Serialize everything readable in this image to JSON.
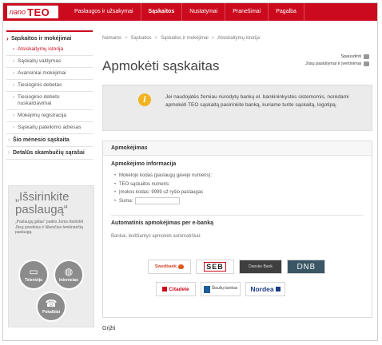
{
  "header": {
    "logo_nano": "nano",
    "logo_teo": "TEO",
    "nav": [
      "Paslaugos ir užsakymai",
      "Sąskaitos",
      "Nustatymai",
      "Pranešimai",
      "Pagalba"
    ],
    "active_nav": "Sąskaitos",
    "brand_color": "#cc0a1e"
  },
  "sidebar": {
    "section_title": "Sąskaitos ir mokėjimai",
    "items": [
      "Atsiskaitymų istorija",
      "Sąskaitų valdymas",
      "Avansiniai mokėjimai",
      "Tiesioginis debetas",
      "Tiesioginio debeto nuskaičiavimai",
      "Mokėjimų registracija",
      "Sąskaitų pateikimo adresas"
    ],
    "active_item": "Atsiskaitymų istorija",
    "extra": [
      "Šio mėnesio sąskaita",
      "Detalūs skambučių sąrašai"
    ]
  },
  "promo": {
    "title": "„Išsirinkite paslaugą“",
    "text": "„Paslaugų gidas“ padės Jums išsirinkti Jūsų poreikius ir lūkesčius tenkinančią paslaugą.",
    "circles": [
      {
        "label": "Televizija",
        "icon": "tv-icon"
      },
      {
        "label": "Internetas",
        "icon": "globe-icon"
      },
      {
        "label": "Pokalbiai",
        "icon": "phone-icon"
      }
    ]
  },
  "breadcrumb": [
    "Namams",
    "Sąskaitos",
    "Sąskaitos ir mokėjimai",
    "Atsiskaitymų istorija"
  ],
  "tools": {
    "print": "Spausdinti",
    "rate": "Jūsų pasiūlymai ir įvertinimai"
  },
  "page_title": "Apmokėti sąskaitas",
  "info": {
    "icon": "info-icon",
    "text": "Jei naudojatės žemiau nurodytų bankų el. bankininkystės sistemomis, norėdami apmokėti TEO sąskaitą pasirinkite banką, kuriame turite sąskaitą, logotipą."
  },
  "panel": {
    "title": "Apmokėjimas",
    "info_title": "Apmokėjimo informacija",
    "info_items": [
      "Mokėtojo kodas (paslaugų gavėjo numeris):",
      "TEO sąskaitos numeris:",
      "Įmokos kodas: 9999 už ryšio paslaugas"
    ],
    "sum_label": "Suma:",
    "sum_value": "",
    "ebank_title": "Automatinis apmokėjimas per e-banką",
    "ebank_desc": "Bankai, leidžiantys apmokėti automatiškai:"
  },
  "banks": [
    "Swedbank",
    "SEB",
    "Danske Bank",
    "DNB",
    "Citadele",
    "Šiaulių bankas",
    "Nordea"
  ],
  "back_link": "Grįžti"
}
